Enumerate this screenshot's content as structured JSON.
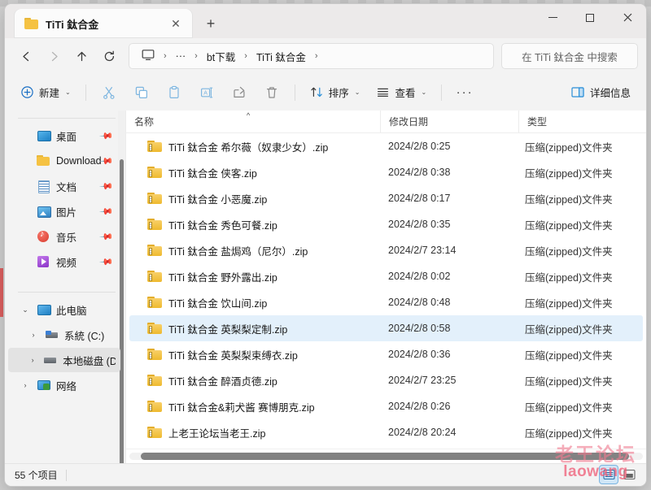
{
  "window": {
    "tab_title": "TiTi 鈦合金",
    "controls": {
      "minimize": "—",
      "maximize": "□",
      "close": "✕"
    },
    "tab_close": "✕",
    "new_tab": "+"
  },
  "address": {
    "back": "←",
    "forward": "→",
    "up": "↑",
    "refresh": "⟳",
    "crumbs": [
      "",
      "···",
      "bt下载",
      "TiTi 鈦合金"
    ],
    "separator": "›",
    "trailing_separator": "›"
  },
  "search": {
    "placeholder": "在 TiTi 鈦合金 中搜索"
  },
  "toolbar": {
    "new_label": "新建",
    "cut_label": "剪切",
    "copy_label": "复制",
    "paste_label": "粘贴",
    "rename_label": "重命名",
    "share_label": "共享",
    "delete_label": "删除",
    "sort_label": "排序",
    "view_label": "查看",
    "more_label": "···",
    "details_label": "详细信息",
    "caret": "⌄"
  },
  "sidebar": {
    "quick": [
      {
        "label": "桌面",
        "icon": "desktop-icon",
        "pinned": true
      },
      {
        "label": "Download",
        "icon": "folder-icon",
        "pinned": true
      },
      {
        "label": "文档",
        "icon": "documents-icon",
        "pinned": true
      },
      {
        "label": "图片",
        "icon": "pictures-icon",
        "pinned": true
      },
      {
        "label": "音乐",
        "icon": "music-icon",
        "pinned": true
      },
      {
        "label": "视频",
        "icon": "videos-icon",
        "pinned": true
      }
    ],
    "tree": [
      {
        "label": "此电脑",
        "icon": "this-pc-icon",
        "chevron": "⌄",
        "selected": false,
        "indent": 0
      },
      {
        "label": "系統 (C:)",
        "icon": "system-drive-icon",
        "chevron": "›",
        "selected": false,
        "indent": 1
      },
      {
        "label": "本地磁盘 (D:)",
        "icon": "local-drive-icon",
        "chevron": "›",
        "selected": true,
        "indent": 1
      },
      {
        "label": "网络",
        "icon": "network-icon",
        "chevron": "›",
        "selected": false,
        "indent": 0
      }
    ],
    "pin_glyph": "📌"
  },
  "columns": {
    "name": "名称",
    "date": "修改日期",
    "type": "类型",
    "sort_indicator": "^"
  },
  "files": [
    {
      "name": "TiTi 鈦合金 希尔薇（奴隶少女）.zip",
      "date": "2024/2/8 0:25",
      "type": "压缩(zipped)文件夹",
      "selected": false
    },
    {
      "name": "TiTi 鈦合金 侠客.zip",
      "date": "2024/2/8 0:38",
      "type": "压缩(zipped)文件夹",
      "selected": false
    },
    {
      "name": "TiTi 鈦合金 小恶魔.zip",
      "date": "2024/2/8 0:17",
      "type": "压缩(zipped)文件夹",
      "selected": false
    },
    {
      "name": "TiTi 鈦合金 秀色可餐.zip",
      "date": "2024/2/8 0:35",
      "type": "压缩(zipped)文件夹",
      "selected": false
    },
    {
      "name": "TiTi 鈦合金 盐焗鸡（尼尔）.zip",
      "date": "2024/2/7 23:14",
      "type": "压缩(zipped)文件夹",
      "selected": false
    },
    {
      "name": "TiTi 鈦合金 野外露出.zip",
      "date": "2024/2/8 0:02",
      "type": "压缩(zipped)文件夹",
      "selected": false
    },
    {
      "name": "TiTi 鈦合金 饮山间.zip",
      "date": "2024/2/8 0:48",
      "type": "压缩(zipped)文件夹",
      "selected": false
    },
    {
      "name": "TiTi 鈦合金 英梨梨定制.zip",
      "date": "2024/2/8 0:58",
      "type": "压缩(zipped)文件夹",
      "selected": true
    },
    {
      "name": "TiTi 鈦合金 英梨梨束缚衣.zip",
      "date": "2024/2/8 0:36",
      "type": "压缩(zipped)文件夹",
      "selected": false
    },
    {
      "name": "TiTi 鈦合金 醉酒贞德.zip",
      "date": "2024/2/7 23:25",
      "type": "压缩(zipped)文件夹",
      "selected": false
    },
    {
      "name": "TiTi 鈦合金&莉犬酱 赛博朋克.zip",
      "date": "2024/2/8 0:26",
      "type": "压缩(zipped)文件夹",
      "selected": false
    },
    {
      "name": "上老王论坛当老王.zip",
      "date": "2024/2/8 20:24",
      "type": "压缩(zipped)文件夹",
      "selected": false
    }
  ],
  "status": {
    "item_count": "55 个项目"
  },
  "watermark": {
    "line1": "老王论坛",
    "line2": "laowang"
  },
  "colors": {
    "selection": "#e3f0fb",
    "accent": "#0f6cbd",
    "watermark": "#ef5c76"
  }
}
